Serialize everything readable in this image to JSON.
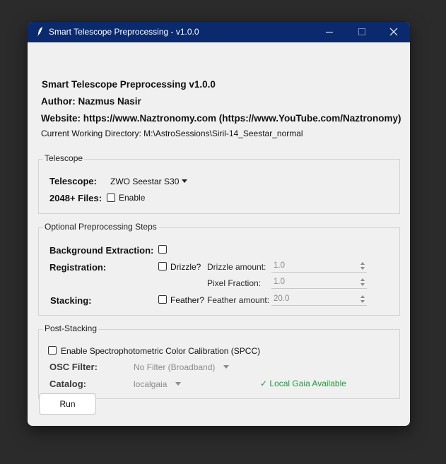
{
  "window": {
    "title": "Smart Telescope Preprocessing - v1.0.0",
    "titlebar_color": "#0b2a6e"
  },
  "header": {
    "app_name": "Smart Telescope Preprocessing v1.0.0",
    "author": "Author: Nazmus Nasir",
    "website": "Website: https://www.Naztronomy.com (https://www.YouTube.com/Naztronomy)",
    "cwd": "Current Working Directory: M:\\AstroSessions\\Siril-14_Seestar_normal"
  },
  "telescope": {
    "group_title": "Telescope",
    "telescope_label": "Telescope:",
    "telescope_value": "ZWO Seestar S30",
    "files_label": "2048+ Files:",
    "enable_label": "Enable",
    "enable_checked": false
  },
  "optional": {
    "group_title": "Optional Preprocessing Steps",
    "bg_label": "Background Extraction:",
    "bg_checked": false,
    "registration_label": "Registration:",
    "drizzle_label": "Drizzle?",
    "drizzle_checked": false,
    "drizzle_amount_label": "Drizzle amount:",
    "drizzle_amount_value": "1.0",
    "pixel_fraction_label": "Pixel Fraction:",
    "pixel_fraction_value": "1.0",
    "stacking_label": "Stacking:",
    "feather_label": "Feather?",
    "feather_checked": false,
    "feather_amount_label": "Feather amount:",
    "feather_amount_value": "20.0"
  },
  "post": {
    "group_title": "Post-Stacking",
    "spcc_label": "Enable Spectrophotometric Color Calibration (SPCC)",
    "spcc_checked": false,
    "osc_label": "OSC Filter:",
    "osc_value": "No Filter (Broadband)",
    "catalog_label": "Catalog:",
    "catalog_value": "localgaia",
    "gaia_status": "✓ Local Gaia Available",
    "gaia_color": "#1a9a3c"
  },
  "actions": {
    "run_label": "Run"
  }
}
